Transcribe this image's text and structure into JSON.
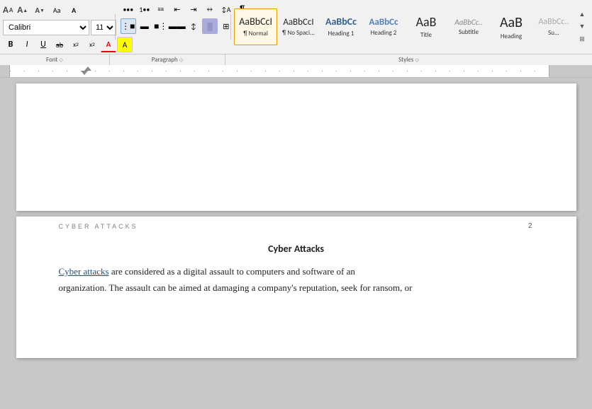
{
  "toolbar": {
    "font_name": "Calibri",
    "font_size": "11",
    "grow_label": "A",
    "shrink_label": "A",
    "clear_format": "A",
    "bold": "B",
    "italic": "I",
    "underline": "U",
    "strikethrough": "ab",
    "subscript": "x₂",
    "superscript": "x²",
    "text_color_label": "A",
    "highlight_label": "A",
    "list_bullet": "≡",
    "list_number": "≡",
    "decrease_indent": "⇤",
    "increase_indent": "⇥",
    "sort_label": "↕",
    "para_mark": "¶",
    "align_left": "≡",
    "align_center": "≡",
    "align_right": "≡",
    "justify": "≡",
    "line_spacing": "↕",
    "shading": "░",
    "borders": "⊞"
  },
  "styles": [
    {
      "id": "normal",
      "label": "¶ Normal",
      "sample": "AaBbCcI",
      "color": "#222",
      "selected": true
    },
    {
      "id": "nospace",
      "label": "¶ No Spaci...",
      "sample": "AaBbCcI",
      "color": "#222",
      "selected": false
    },
    {
      "id": "heading1",
      "label": "Heading 1",
      "sample": "AaBbCc",
      "color": "#365f91",
      "selected": false
    },
    {
      "id": "heading2",
      "label": "Heading 2",
      "sample": "AaBbCc",
      "color": "#4f81bd",
      "selected": false
    },
    {
      "id": "title",
      "label": "Title",
      "sample": "AaB",
      "color": "#222",
      "selected": false
    },
    {
      "id": "subtitle",
      "label": "Subtitle",
      "sample": "AaBbCc..",
      "color": "#888",
      "selected": false
    },
    {
      "id": "heading",
      "label": "Heading",
      "sample": "AaB",
      "color": "#222",
      "selected": false
    }
  ],
  "sections": {
    "font_label": "Font",
    "paragraph_label": "Paragraph",
    "styles_label": "Styles"
  },
  "ruler": {
    "visible": true
  },
  "page1": {
    "content": ""
  },
  "page2": {
    "header_title": "CYBER ATTACKS",
    "header_page": "2",
    "title": "Cyber Attacks",
    "paragraph1_link": "Cyber attacks",
    "paragraph1_rest": " are considered as a digital assault to computers and software of an",
    "paragraph2": "organization.  The assault can be aimed at damaging a company's reputation, seek for ransom, or"
  }
}
